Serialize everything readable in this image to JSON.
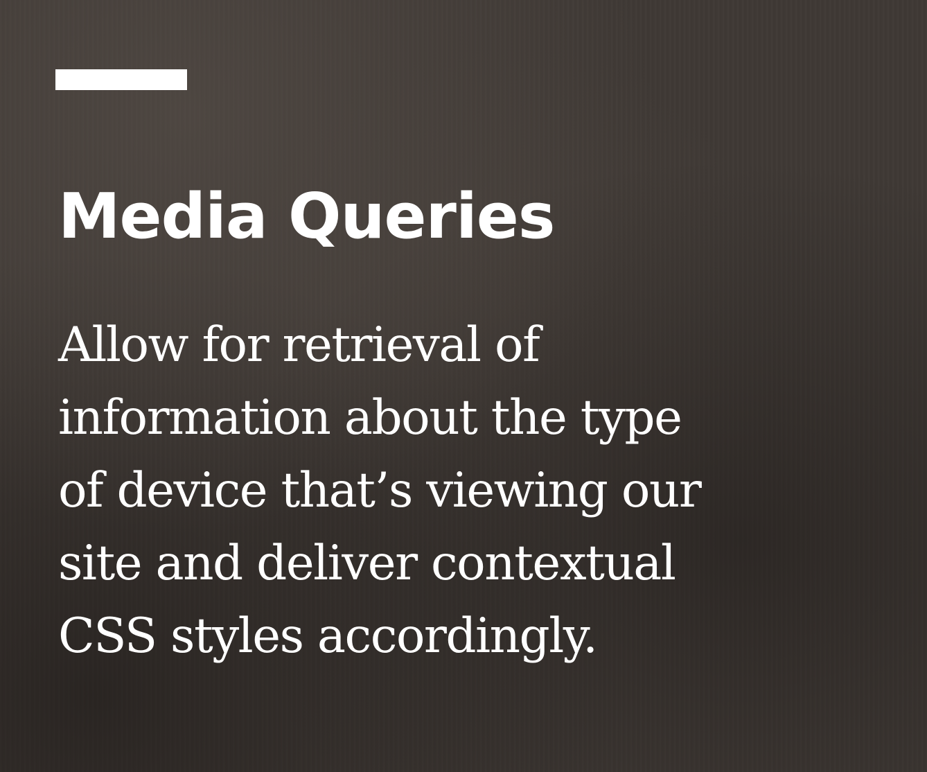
{
  "slide": {
    "title": "Media Queries",
    "body_lines": [
      "Allow for retrieval of",
      "information about the type",
      "of device that’s viewing our",
      "site and deliver contextual",
      "CSS styles accordingly."
    ]
  },
  "colors": {
    "background": "#3f3935",
    "text": "#ffffff",
    "accent_bar": "#ffffff"
  }
}
